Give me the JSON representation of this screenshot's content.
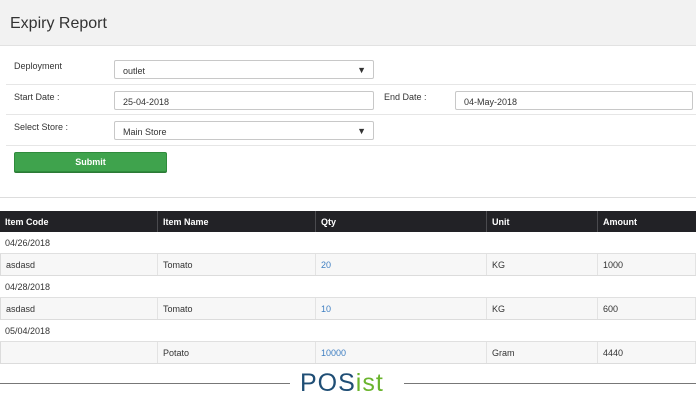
{
  "page": {
    "title": "Expiry Report"
  },
  "form": {
    "deployment_label": "Deployment",
    "deployment_value": "outlet",
    "start_date_label": "Start Date :",
    "start_date_value": "25-04-2018",
    "end_date_label": "End Date :",
    "end_date_value": "04-May-2018",
    "store_label": "Select Store :",
    "store_value": "Main Store",
    "submit_label": "Submit"
  },
  "table": {
    "headers": [
      "Item Code",
      "Item Name",
      "Qty",
      "Unit",
      "Amount"
    ],
    "groups": [
      {
        "date": "04/26/2018",
        "row": [
          "asdasd",
          "Tomato",
          "20",
          "KG",
          "1000"
        ]
      },
      {
        "date": "04/28/2018",
        "row": [
          "asdasd",
          "Tomato",
          "10",
          "KG",
          "600"
        ]
      },
      {
        "date": "05/04/2018",
        "row": [
          "",
          "Potato",
          "10000",
          "Gram",
          "4440"
        ]
      }
    ]
  },
  "footer": {
    "brand_main": "POS",
    "brand_accent": "ist"
  },
  "colors": {
    "header_bg": "#222226",
    "submit_bg": "#3fa34d",
    "qty_link": "#3f7fc2",
    "brand_blue": "#1f4e75",
    "brand_green": "#6ab42d"
  },
  "icons": {
    "dropdown": "chevron-down-icon"
  }
}
